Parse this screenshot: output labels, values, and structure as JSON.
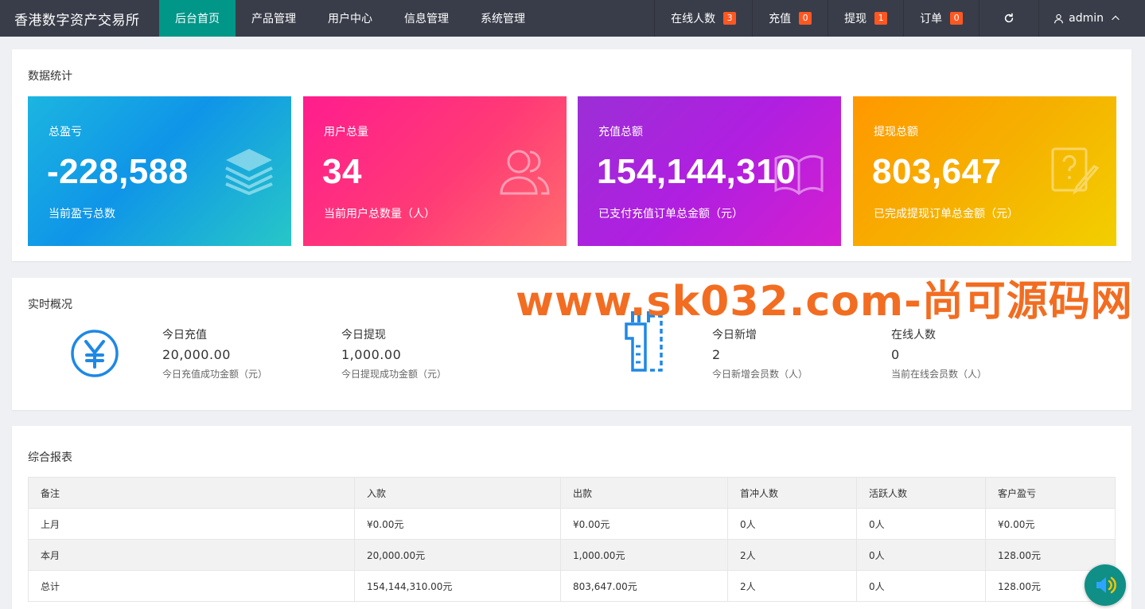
{
  "brand": "香港数字资产交易所",
  "nav": {
    "items": [
      {
        "label": "后台首页"
      },
      {
        "label": "产品管理"
      },
      {
        "label": "用户中心"
      },
      {
        "label": "信息管理"
      },
      {
        "label": "系统管理"
      }
    ]
  },
  "right_nav": {
    "online": {
      "label": "在线人数",
      "badge": "3"
    },
    "recharge": {
      "label": "充值",
      "badge": "0"
    },
    "withdraw": {
      "label": "提现",
      "badge": "1"
    },
    "orders": {
      "label": "订单",
      "badge": "0"
    },
    "user": "admin"
  },
  "stats": {
    "title": "数据统计",
    "cards": [
      {
        "title": "总盈亏",
        "value": "-228,588",
        "desc": "当前盈亏总数",
        "icon": "layers-icon"
      },
      {
        "title": "用户总量",
        "value": "34",
        "desc": "当前用户总数量（人）",
        "icon": "users-icon"
      },
      {
        "title": "充值总额",
        "value": "154,144,310",
        "desc": "已支付充值订单总金额（元）",
        "icon": "book-icon"
      },
      {
        "title": "提现总额",
        "value": "803,647",
        "desc": "已完成提现订单总金额（元）",
        "icon": "question-note-icon"
      }
    ]
  },
  "realtime": {
    "title": "实时概况",
    "items": [
      {
        "label": "今日充值",
        "value": "20,000.00",
        "desc": "今日充值成功金额（元）"
      },
      {
        "label": "今日提现",
        "value": "1,000.00",
        "desc": "今日提现成功金额（元）"
      },
      {
        "label": "今日新增",
        "value": "2",
        "desc": "今日新增会员数（人）"
      },
      {
        "label": "在线人数",
        "value": "0",
        "desc": "当前在线会员数（人）"
      }
    ]
  },
  "report": {
    "title": "综合报表",
    "columns": [
      "备注",
      "入款",
      "出款",
      "首冲人数",
      "活跃人数",
      "客户盈亏"
    ],
    "rows": [
      [
        "上月",
        "¥0.00元",
        "¥0.00元",
        "0人",
        "0人",
        "¥0.00元"
      ],
      [
        "本月",
        "20,000.00元",
        "1,000.00元",
        "2人",
        "0人",
        "128.00元"
      ],
      [
        "总计",
        "154,144,310.00元",
        "803,647.00元",
        "2人",
        "0人",
        "128.00元"
      ]
    ]
  },
  "watermark": "www.sk032.com-尚可源码网",
  "colors": {
    "topbar": "#393d49",
    "active_nav": "#009688",
    "badge": "#ff5722",
    "realtime_icon": "#1e88e5",
    "watermark": "#f26d21"
  }
}
